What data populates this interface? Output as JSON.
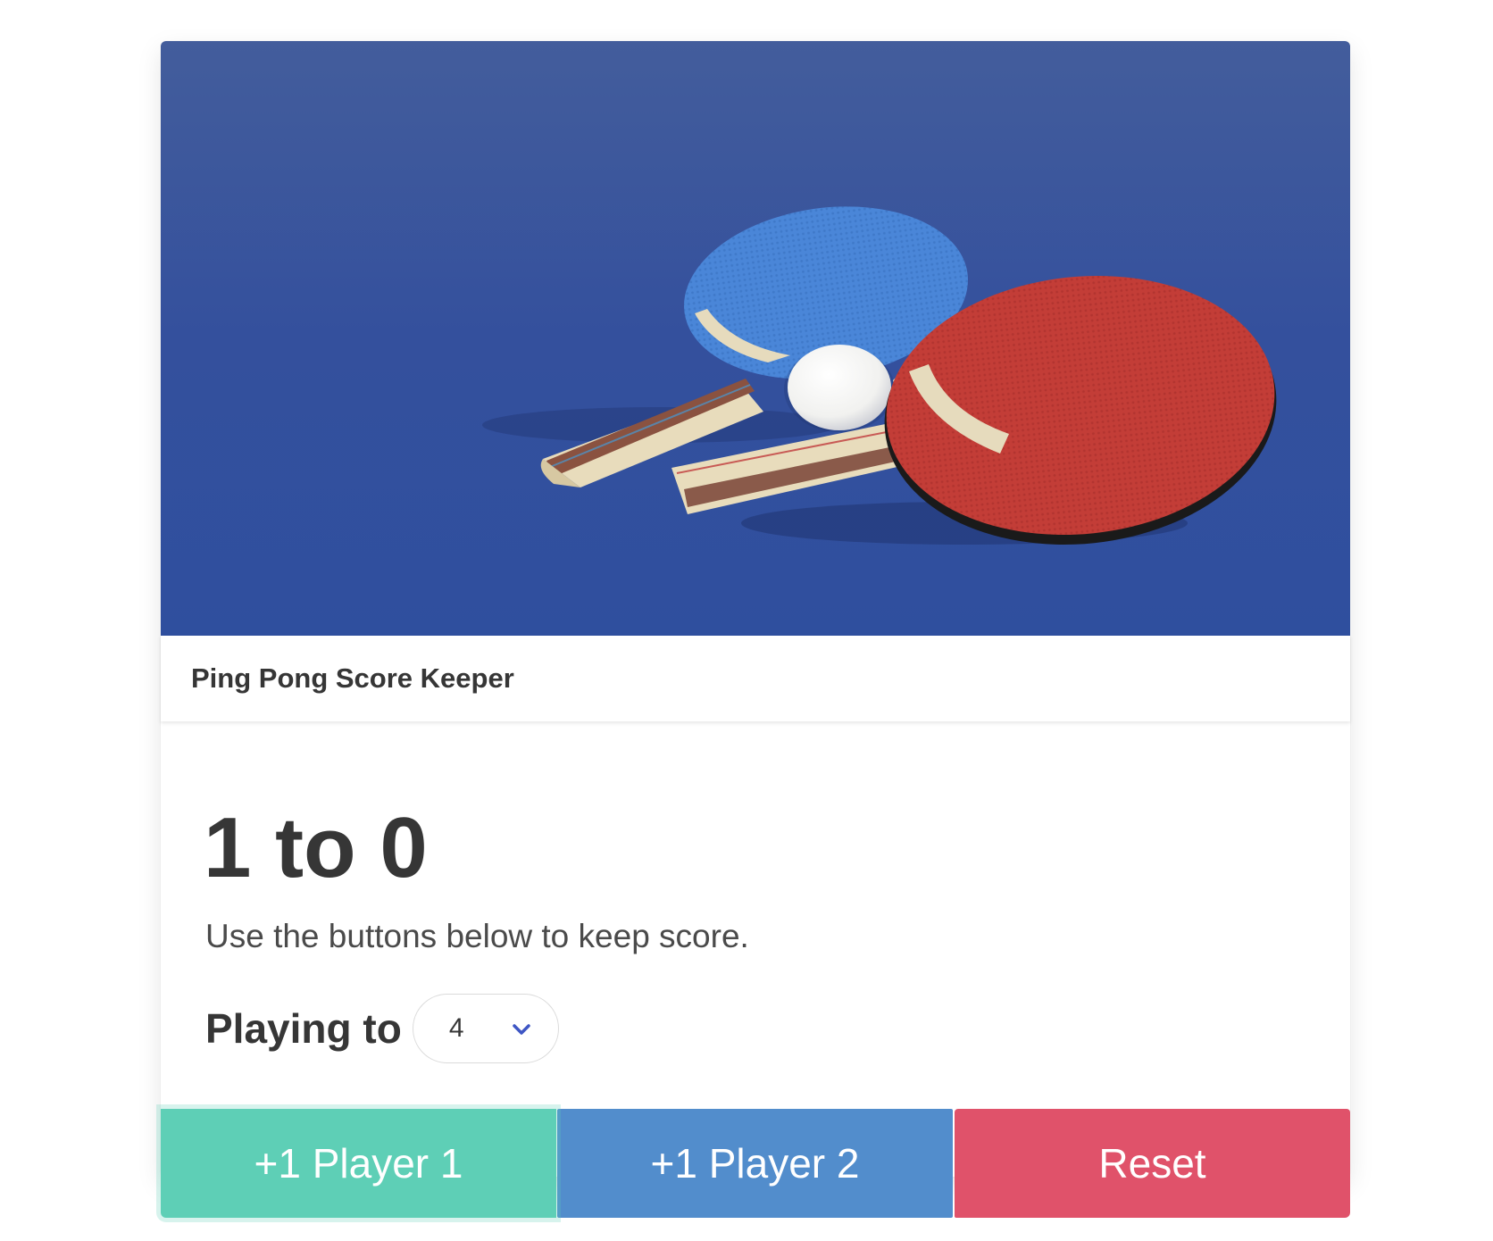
{
  "card": {
    "title": "Ping Pong Score Keeper",
    "image_alt": "ping pong paddles and ball"
  },
  "score": {
    "player1": 1,
    "player2": 0,
    "text": "1 to 0"
  },
  "instructions": "Use the buttons below to keep score.",
  "playing_to": {
    "label": "Playing to",
    "selected": "4"
  },
  "buttons": {
    "player1": "+1 Player 1",
    "player2": "+1 Player 2",
    "reset": "Reset"
  },
  "colors": {
    "player1_button": "#5ecfb6",
    "player2_button": "#528dcc",
    "reset_button": "#e0526a",
    "select_arrow": "#3e56c4",
    "table_blue": "#35519e"
  },
  "icons": {
    "select_arrow": "chevron-down-icon"
  }
}
